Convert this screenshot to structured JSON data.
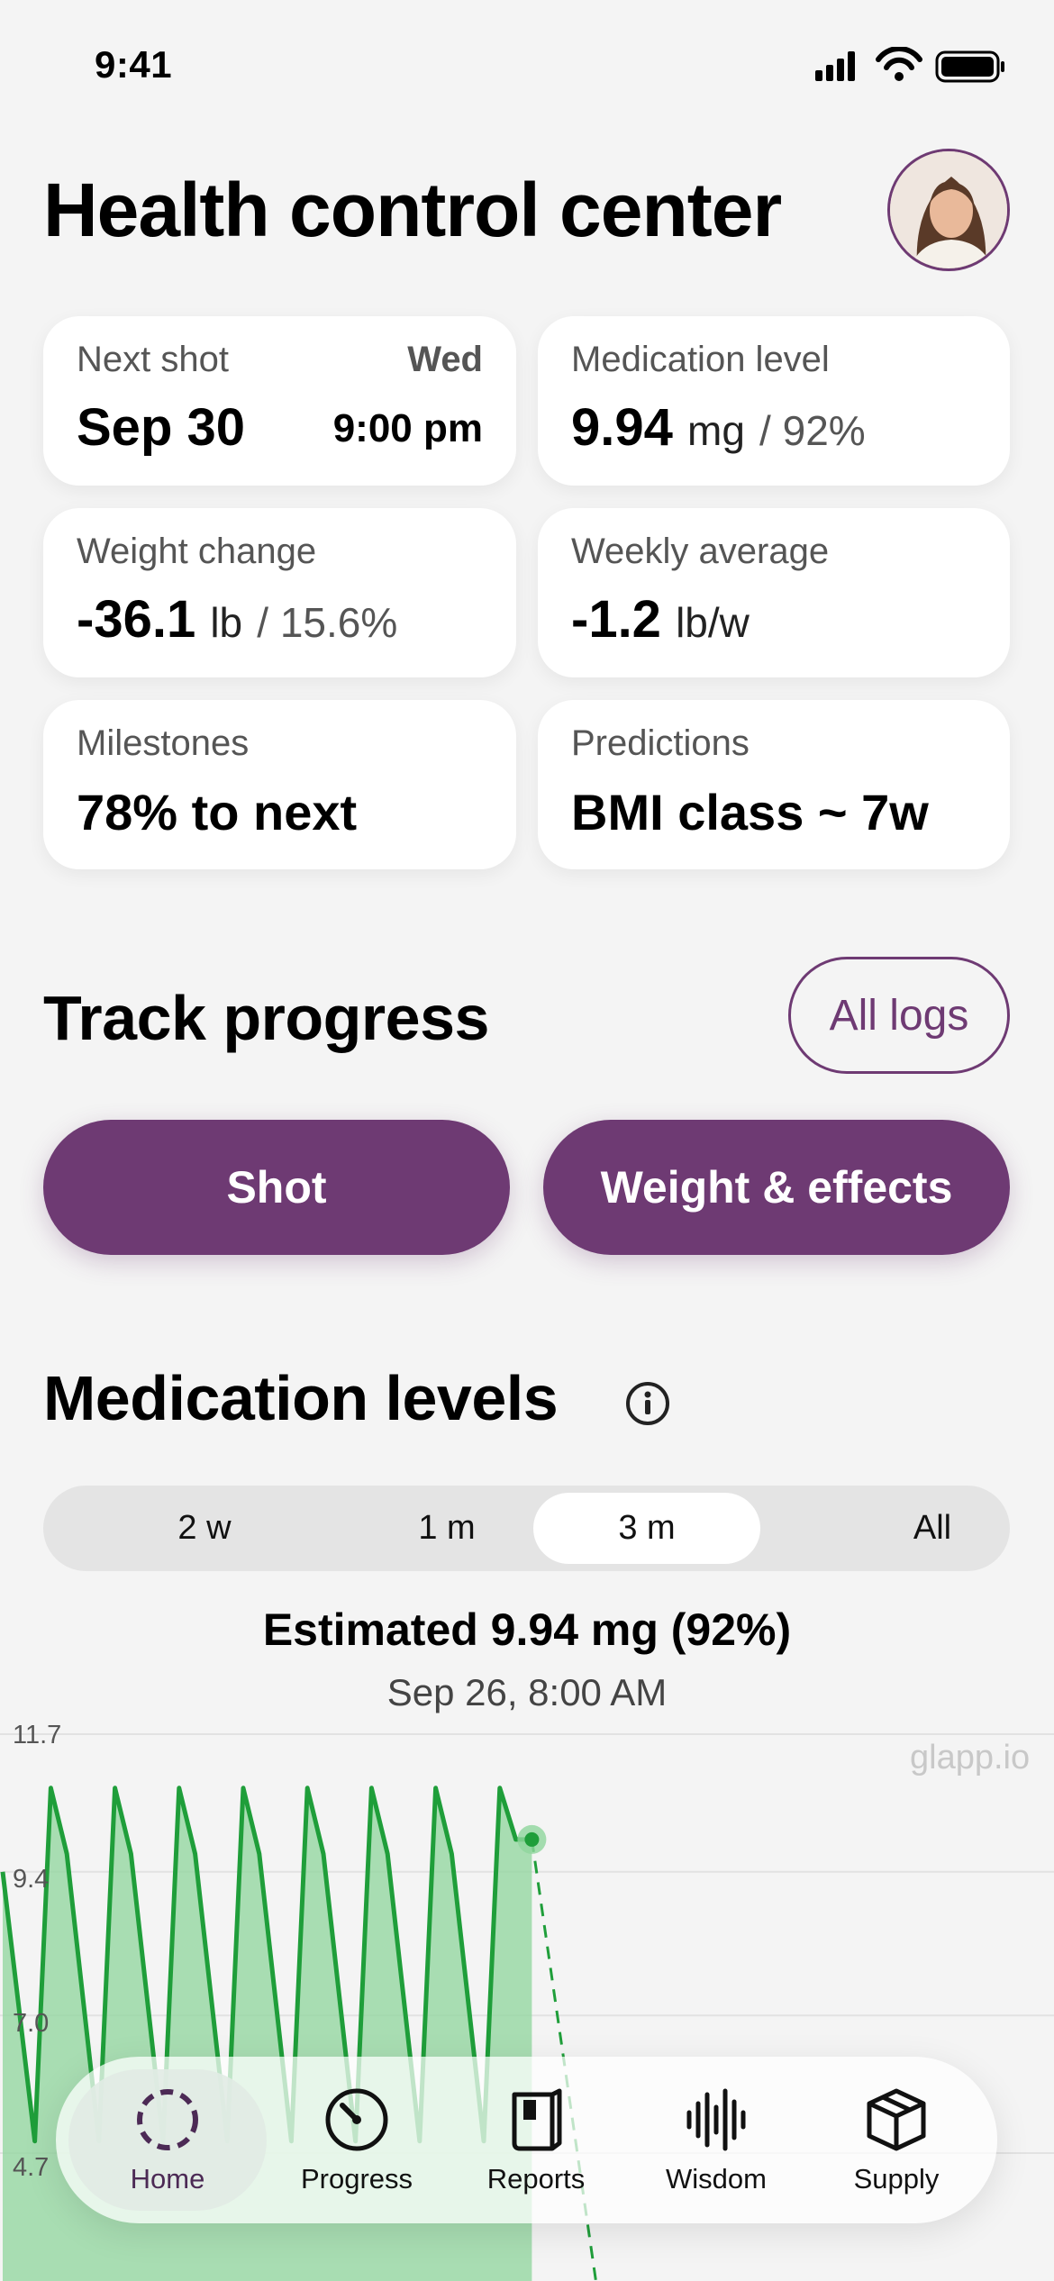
{
  "status": {
    "time": "9:41"
  },
  "header": {
    "title": "Health control center"
  },
  "cards": {
    "next_shot": {
      "label": "Next shot",
      "day": "Wed",
      "date": "Sep 30",
      "time": "9:00 pm"
    },
    "medication_level": {
      "label": "Medication level",
      "value": "9.94",
      "unit": "mg",
      "percent": "/ 92%"
    },
    "weight_change": {
      "label": "Weight change",
      "value": "-36.1",
      "unit": "lb",
      "percent": "/ 15.6%"
    },
    "weekly_average": {
      "label": "Weekly average",
      "value": "-1.2",
      "unit": "lb/w"
    },
    "milestones": {
      "label": "Milestones",
      "value": "78% to next"
    },
    "predictions": {
      "label": "Predictions",
      "value": "BMI class ~ 7w"
    }
  },
  "track": {
    "title": "Track progress",
    "all_logs": "All logs",
    "shot": "Shot",
    "weight_effects": "Weight & effects"
  },
  "medication": {
    "title": "Medication levels",
    "ranges": [
      "2 w",
      "1 m",
      "3 m",
      "All"
    ],
    "selected_range": "3 m",
    "estimate": "Estimated 9.94 mg (92%)",
    "timestamp": "Sep 26, 8:00 AM",
    "watermark": "glapp.io"
  },
  "chart_data": {
    "type": "area",
    "yticks": [
      "11.7",
      "9.4",
      "7.0",
      "4.7"
    ],
    "ylim": [
      4.7,
      11.7
    ],
    "x_index": [
      0,
      2,
      3,
      4,
      6,
      7,
      8,
      10,
      11,
      12,
      14,
      15,
      16,
      18,
      19,
      20,
      22,
      23,
      24,
      26,
      27,
      28,
      30,
      31,
      32,
      33
    ],
    "values": [
      9.4,
      4.9,
      10.8,
      9.7,
      4.9,
      10.8,
      9.7,
      4.9,
      10.8,
      9.7,
      4.9,
      10.8,
      9.7,
      4.9,
      10.8,
      9.7,
      4.9,
      10.8,
      9.7,
      4.9,
      10.8,
      9.7,
      4.9,
      10.8,
      9.94,
      9.94
    ],
    "projection": [
      [
        33,
        9.94
      ],
      [
        35,
        4.2
      ]
    ],
    "colors": {
      "line": "#1f9e3a",
      "fill": "#8fd69c",
      "accent": "#6e3a73"
    }
  },
  "tabs": [
    {
      "label": "Home",
      "icon": "home-ring-icon"
    },
    {
      "label": "Progress",
      "icon": "gauge-icon"
    },
    {
      "label": "Reports",
      "icon": "book-icon"
    },
    {
      "label": "Wisdom",
      "icon": "waveform-icon"
    },
    {
      "label": "Supply",
      "icon": "box-icon"
    }
  ]
}
